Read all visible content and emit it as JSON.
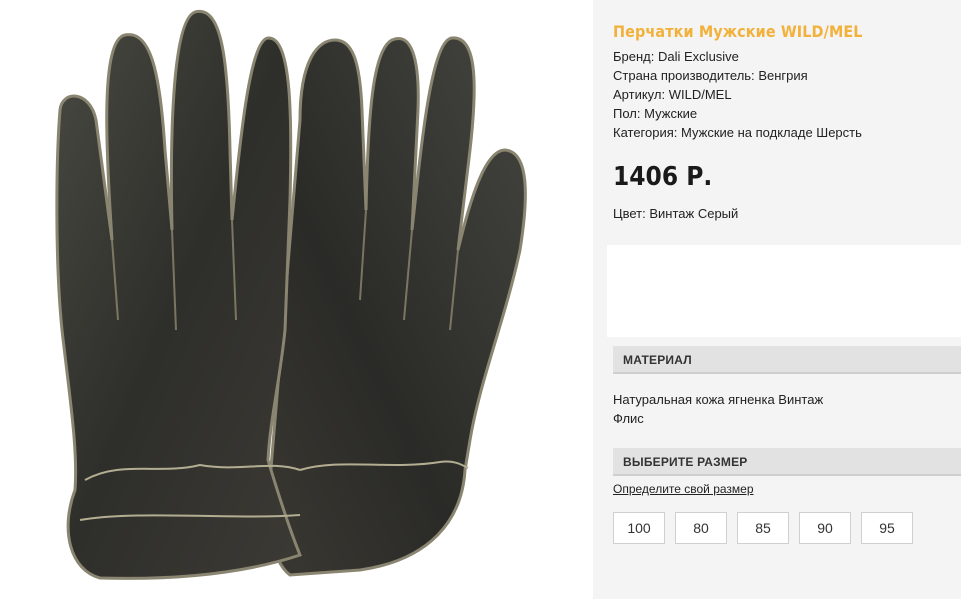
{
  "product": {
    "title": "Перчатки Мужские WILD/MEL",
    "specs": [
      {
        "label": "Бренд:",
        "value": "Dali Exclusive"
      },
      {
        "label": "Страна производитель:",
        "value": "Венгрия"
      },
      {
        "label": "Артикул:",
        "value": "WILD/MEL"
      },
      {
        "label": "Пол:",
        "value": "Мужские"
      },
      {
        "label": "Категория:",
        "value": "Мужские на подкладе Шерсть"
      }
    ],
    "price": "1406 Р.",
    "color_label": "Цвет:",
    "color_value": "Винтаж Серый",
    "image_icon": "leather-gloves-photo"
  },
  "material": {
    "header": "МАТЕРИАЛ",
    "lines": [
      "Натуральная кожа ягненка Винтаж",
      "Флис"
    ]
  },
  "size": {
    "header": "ВЫБЕРИТЕ РАЗМЕР",
    "help_link": "Определите свой размер",
    "options": [
      "100",
      "80",
      "85",
      "90",
      "95"
    ]
  },
  "colors": {
    "accent": "#f2b13a",
    "panel_bg": "#f4f4f4",
    "header_bg": "#e2e2e2"
  }
}
